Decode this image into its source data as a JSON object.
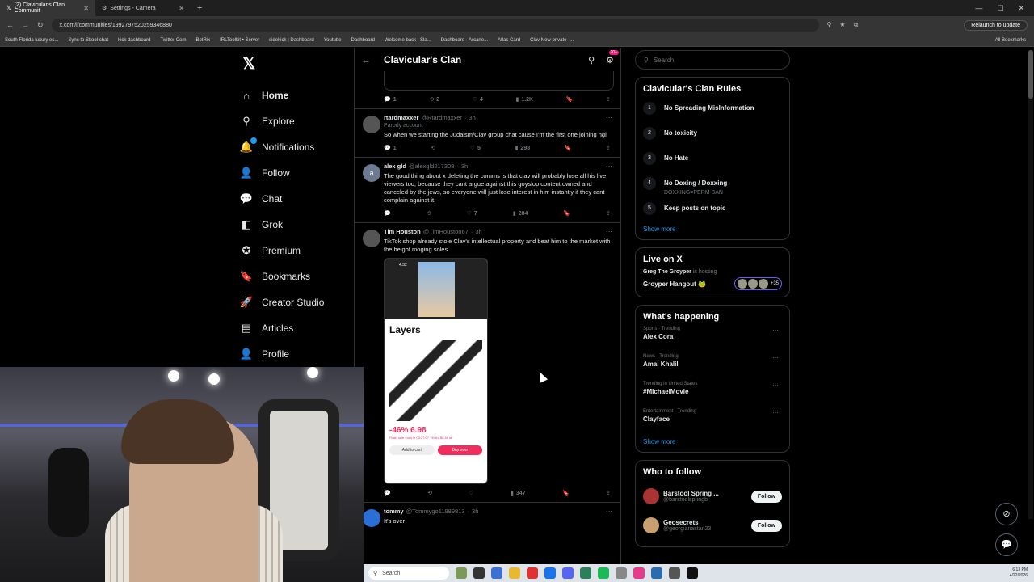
{
  "browser": {
    "tabs": [
      {
        "label": "(2) Clavicular's Clan Communit",
        "active": true
      },
      {
        "label": "Settings - Camera",
        "active": false
      }
    ],
    "url": "x.com/i/communities/1992797520259346880",
    "relaunch": "Relaunch to update",
    "bookmarks": [
      "South Florida luxury es...",
      "Sync to Skool chat",
      "kick dashboard",
      "Twitter Com",
      "BotRix",
      "IRLToolkit • Server",
      "sidekick | Dashboard",
      "Youtube",
      "Dashboard",
      "Welcome back | Sla...",
      "Dashboard - Arcane...",
      "Atlas Card",
      "Clav New private -..."
    ],
    "all_bookmarks": "All Bookmarks"
  },
  "nav": {
    "logo": "𝕏",
    "items": [
      {
        "label": "Home",
        "icon": "⌂"
      },
      {
        "label": "Explore",
        "icon": "⚲"
      },
      {
        "label": "Notifications",
        "icon": "🔔"
      },
      {
        "label": "Follow",
        "icon": "👤"
      },
      {
        "label": "Chat",
        "icon": "💬"
      },
      {
        "label": "Grok",
        "icon": "◧"
      },
      {
        "label": "Premium",
        "icon": "✪"
      },
      {
        "label": "Bookmarks",
        "icon": "🔖"
      },
      {
        "label": "Creator Studio",
        "icon": "🚀"
      },
      {
        "label": "Articles",
        "icon": "▤"
      },
      {
        "label": "Profile",
        "icon": "👤"
      }
    ]
  },
  "community": {
    "title": "Clavicular's Clan",
    "badge": "20+",
    "first_actions": {
      "replies": "1",
      "reposts": "2",
      "likes": "4",
      "views": "1.2K"
    }
  },
  "tweets": [
    {
      "name": "rtardmaxxer",
      "handle": "@Rtardmaxxer",
      "time": "3h",
      "parody": "Parody account",
      "text": "So when we starting the Judaism/Clav group chat cause I'm the first one joining ngl",
      "replies": "1",
      "reposts": "",
      "likes": "5",
      "views": "298",
      "avatar": ""
    },
    {
      "name": "alex gld",
      "handle": "@alexgld217308",
      "time": "3h",
      "parody": "",
      "text": "The good thing about x deleting the comms is that clav will probably lose all his live viewers too, because they cant argue against this goyslop content owned and canceled by the jews, so everyone will just lose interest in him instantly if they cant complain against it.",
      "replies": "",
      "reposts": "",
      "likes": "7",
      "views": "284",
      "avatar": "a"
    },
    {
      "name": "Tim Houston",
      "handle": "@TimHouston67",
      "time": "3h",
      "parody": "",
      "text": "TikTok shop already stole Clav's intellectual property and beat him to the market with the height moging soles",
      "replies": "",
      "reposts": "",
      "likes": "",
      "views": "347",
      "avatar": ""
    },
    {
      "name": "tommy",
      "handle": "@Tommygo11989813",
      "time": "3h",
      "parody": "",
      "text": "It's over",
      "replies": "",
      "reposts": "",
      "likes": "",
      "views": "",
      "avatar": ""
    }
  ],
  "media": {
    "time": "4:32",
    "brand": "Layers",
    "price": "-46% 6.98",
    "fine": "Flash sale ends in 03:27:07 · Extra $0.59 off",
    "cart": "Add to cart",
    "buy": "Buy now"
  },
  "right": {
    "search_placeholder": "Search",
    "rules_title": "Clavicular's Clan Rules",
    "rules": [
      {
        "n": "1",
        "t": "No Spreading MisInformation",
        "d": ""
      },
      {
        "n": "2",
        "t": "No toxicity",
        "d": ""
      },
      {
        "n": "3",
        "t": "No Hate",
        "d": ""
      },
      {
        "n": "4",
        "t": "No Doxing / Doxxing",
        "d": "DOXXING=PERM BAN"
      },
      {
        "n": "5",
        "t": "Keep posts on topic",
        "d": ""
      }
    ],
    "show_more": "Show more",
    "live_title": "Live on X",
    "live_host": "Greg The Groyper",
    "live_status": "is hosting",
    "live_room": "Groyper Hangout 🐸",
    "live_count": "+35",
    "happening_title": "What's happening",
    "trends": [
      {
        "c": "Sports · Trending",
        "n": "Alex Cora"
      },
      {
        "c": "News · Trending",
        "n": "Amal Khalil"
      },
      {
        "c": "Trending in United States",
        "n": "#MichaelMovie"
      },
      {
        "c": "Entertainment · Trending",
        "n": "Clayface"
      }
    ],
    "wtf_title": "Who to follow",
    "wtf": [
      {
        "name": "Barstool Spring ...",
        "handle": "@barstoolspringb",
        "btn": "Follow"
      },
      {
        "name": "Geosecrets",
        "handle": "@georgianastan23",
        "btn": "Follow"
      }
    ]
  },
  "taskbar": {
    "search": "Search",
    "time": "6:13 PM",
    "date": "4/22/2026"
  }
}
